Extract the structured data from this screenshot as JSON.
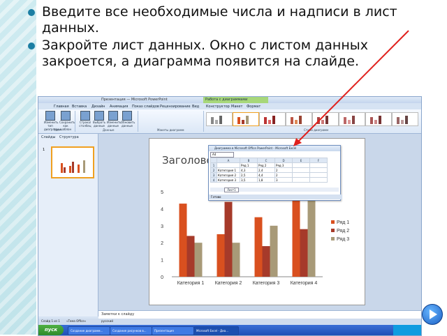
{
  "slide": {
    "bullets": [
      "Введите все необходимые числа и надписи в лист данных.",
      "Закройте лист данных. Окно с листом данных закроется, а диаграмма появится на слайде."
    ]
  },
  "ppt": {
    "window_title": "Презентация — Microsoft PowerPoint",
    "context_tab": "Работа с диаграммами",
    "tabs": [
      "Главная",
      "Вставка",
      "Дизайн",
      "Анимация",
      "Показ слайдов",
      "Рецензирование",
      "Вид",
      "Конструктор",
      "Макет",
      "Формат"
    ],
    "ribbon_buttons": [
      "Изменить тип диаграммы",
      "Сохранить как шаблон",
      "Строка/столбец",
      "Выбрать данные",
      "Изменить данные",
      "Обновить данные"
    ],
    "ribbon_groups": [
      "Тип",
      "Данные",
      "Макеты диаграмм",
      "Стили диаграмм"
    ],
    "pane_tabs": [
      "Слайды",
      "Структура"
    ],
    "thumb_number": "1",
    "slide_title": "Заголовок",
    "notes_placeholder": "Заметки к слайду",
    "status_left": "Слайд 1 из 1",
    "status_theme": "«Тема Office»",
    "status_lang": "русский",
    "start_label": "пуск",
    "taskbar_items": [
      "Создание диаграмм...",
      "Создание рисунков в...",
      "Презентация",
      "Microsoft Excel - Диа..."
    ]
  },
  "datasheet": {
    "title": "Диаграмма в Microsoft Office PowerPoint - Microsoft Excel",
    "namebox": "A4",
    "columns": [
      "",
      "A",
      "B",
      "C",
      "D",
      "E",
      "F"
    ],
    "rows": [
      [
        "1",
        "",
        "Ряд 1",
        "Ряд 2",
        "Ряд 3",
        "",
        ""
      ],
      [
        "2",
        "Категория 1",
        "4,3",
        "2,4",
        "2",
        "",
        ""
      ],
      [
        "3",
        "Категория 2",
        "2,5",
        "4,4",
        "2",
        "",
        ""
      ],
      [
        "4",
        "Категория 3",
        "3,5",
        "1,8",
        "3",
        "",
        ""
      ]
    ],
    "sheet_tab": "Лист1",
    "status": "Готово"
  },
  "chart_data": {
    "type": "bar",
    "categories": [
      "Категория 1",
      "Категория 2",
      "Категория 3",
      "Категория 4"
    ],
    "series": [
      {
        "name": "Ряд 1",
        "values": [
          4.3,
          2.5,
          3.5,
          4.5
        ],
        "color": "#d9501f"
      },
      {
        "name": "Ряд 2",
        "values": [
          2.4,
          4.4,
          1.8,
          2.8
        ],
        "color": "#a63a2a"
      },
      {
        "name": "Ряд 3",
        "values": [
          2,
          2,
          3,
          5
        ],
        "color": "#a89a78"
      }
    ],
    "ylim": [
      0,
      5
    ],
    "yticks": [
      "0",
      "1",
      "2",
      "3",
      "4",
      "5"
    ],
    "legend": "right",
    "grid": false
  },
  "colors": {
    "bullet": "#1c7ea3",
    "arrow": "#e0201c"
  }
}
